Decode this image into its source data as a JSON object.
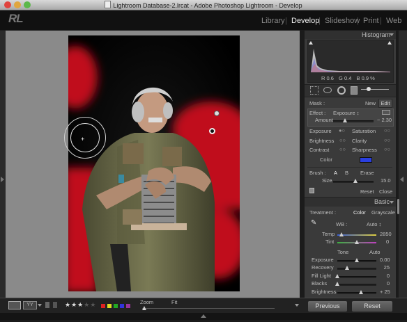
{
  "window": {
    "title": "Lightroom Database-2.lrcat - Adobe Photoshop Lightroom - Develop"
  },
  "modules": [
    "Library",
    "Develop",
    "Slideshow",
    "Print",
    "Web"
  ],
  "active_module": "Develop",
  "logo": "RL",
  "histogram": {
    "header": "Histogram",
    "r_label": "R",
    "r_value": "0.6",
    "g_label": "G",
    "g_value": "0.4",
    "b_label": "B",
    "b_value": "0.9",
    "pct": "%"
  },
  "mask": {
    "label": "Mask :",
    "new": "New",
    "edit": "Edit"
  },
  "effect": {
    "label": "Effect :",
    "value": "Exposure",
    "arrow": "↕",
    "amount_label": "Amount",
    "amount_value": "− 2.30",
    "amount_level": 0.3
  },
  "effects_grid": {
    "left": [
      "Exposure",
      "Brightness",
      "Contrast",
      "Color"
    ],
    "right": [
      "Saturation",
      "Clarity",
      "Sharpness"
    ]
  },
  "brush": {
    "label": "Brush :",
    "a": "A",
    "b": "B",
    "erase": "Erase",
    "size_label": "Size",
    "size_value": "15.0",
    "size_level": 0.55
  },
  "panel_buttons": {
    "reset": "Reset",
    "close": "Close"
  },
  "basic": {
    "header": "Basic",
    "treatment_label": "Treatment :",
    "treatment_color": "Color",
    "treatment_gray": "Grayscale",
    "wb_label": "WB :",
    "wb_value": "Auto",
    "temp_label": "Temp",
    "temp_value": "2850",
    "temp_level": 0.1,
    "tint_label": "Tint",
    "tint_value": "0",
    "tint_level": 0.5,
    "tone_label": "Tone",
    "tone_auto": "Auto",
    "rows": [
      {
        "label": "Exposure",
        "value": "0.00",
        "level": 0.5
      },
      {
        "label": "Recovery",
        "value": "25",
        "level": 0.25
      },
      {
        "label": "Fill Light",
        "value": "0",
        "level": 0.0
      },
      {
        "label": "Blacks",
        "value": "0",
        "level": 0.0
      },
      {
        "label": "Brightness",
        "value": "+ 25",
        "level": 0.6
      },
      {
        "label": "Contrast",
        "value": "0",
        "level": 0.5
      }
    ]
  },
  "toolbar": {
    "stars": "★★★★★",
    "zoom_label": "Zoom",
    "zoom_value": "Fit",
    "previous": "Previous",
    "reset": "Reset (Adobe)",
    "yy": "YY"
  },
  "colors": {
    "mask_overlay": "#c0101a",
    "label_red": "#d22",
    "label_yellow": "#dd2",
    "label_green": "#2a2",
    "label_blue": "#33d",
    "label_purple": "#939"
  }
}
